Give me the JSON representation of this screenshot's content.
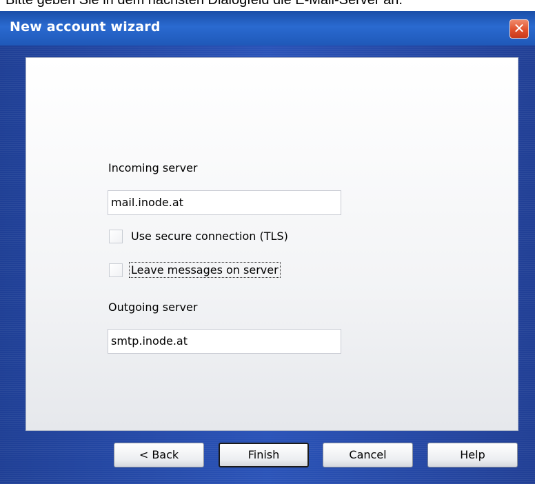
{
  "caption": "Bitte geben Sie in dem nächsten Dialogfeld die E-Mail-Server an.",
  "window": {
    "title": "New account wizard",
    "close_glyph": "✕"
  },
  "form": {
    "incoming_label": "Incoming server",
    "incoming_value": "mail.inode.at",
    "tls_label": "Use secure connection (TLS)",
    "tls_checked": false,
    "leave_label": "Leave messages on server",
    "leave_checked": false,
    "outgoing_label": "Outgoing server",
    "outgoing_value": "smtp.inode.at"
  },
  "buttons": {
    "back": "< Back",
    "finish": "Finish",
    "cancel": "Cancel",
    "help": "Help"
  },
  "colors": {
    "title_bar": "#2a6ad0",
    "window_body": "#2a53b8",
    "close_button": "#e0502c"
  },
  "icons": {
    "close": "close-icon"
  }
}
